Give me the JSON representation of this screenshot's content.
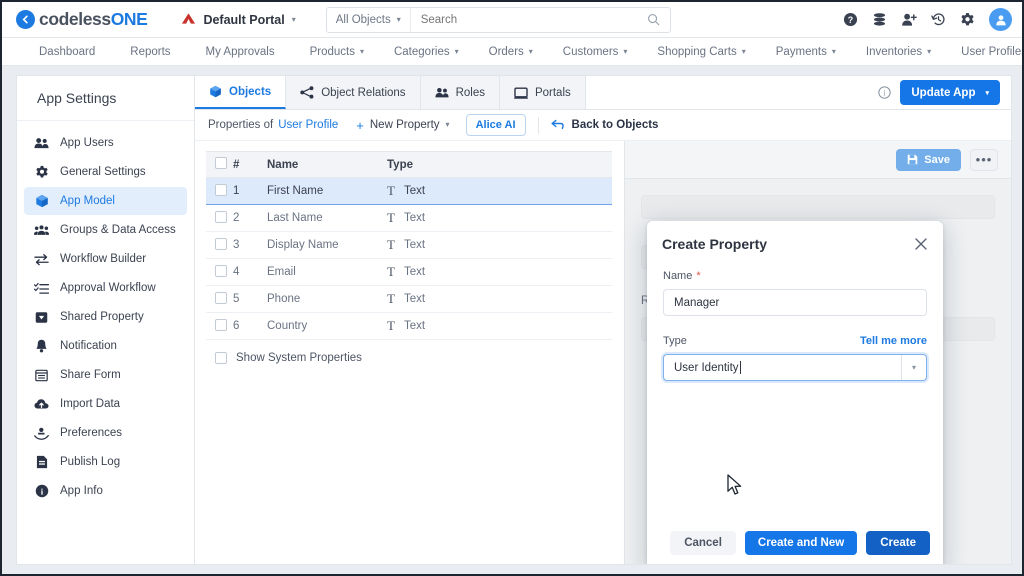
{
  "header": {
    "logo_mark": "circle-arrow-icon",
    "logo_text_1": "codeless",
    "logo_text_2": "ONE",
    "portal_icon": "portal-icon",
    "portal_name": "Default Portal",
    "portal_caret": "▾",
    "search": {
      "scope_label": "All Objects",
      "scope_caret": "▾",
      "placeholder": "Search",
      "value": "",
      "icon": "search-icon"
    },
    "icons": [
      {
        "name": "help-icon"
      },
      {
        "name": "database-icon"
      },
      {
        "name": "add-user-icon"
      },
      {
        "name": "history-icon"
      },
      {
        "name": "gear-icon"
      },
      {
        "name": "avatar-icon"
      }
    ]
  },
  "nav": {
    "items": [
      {
        "label": "Dashboard",
        "caret": ""
      },
      {
        "label": "Reports",
        "caret": ""
      },
      {
        "label": "My Approvals",
        "caret": ""
      },
      {
        "label": "Products",
        "caret": "▾"
      },
      {
        "label": "Categories",
        "caret": "▾"
      },
      {
        "label": "Orders",
        "caret": "▾"
      },
      {
        "label": "Customers",
        "caret": "▾"
      },
      {
        "label": "Shopping Carts",
        "caret": "▾"
      },
      {
        "label": "Payments",
        "caret": "▾"
      },
      {
        "label": "Inventories",
        "caret": "▾"
      },
      {
        "label": "User Profiles",
        "caret": "▾"
      }
    ]
  },
  "sidebar": {
    "title": "App Settings",
    "items": [
      {
        "label": "App Users",
        "icon": "users-icon",
        "active": false
      },
      {
        "label": "General Settings",
        "icon": "gear-icon",
        "active": false
      },
      {
        "label": "App Model",
        "icon": "cube-icon",
        "active": true
      },
      {
        "label": "Groups & Data Access",
        "icon": "group-users-icon",
        "active": false
      },
      {
        "label": "Workflow Builder",
        "icon": "arrows-icon",
        "active": false
      },
      {
        "label": "Approval Workflow",
        "icon": "checklist-icon",
        "active": false
      },
      {
        "label": "Shared Property",
        "icon": "tag-icon",
        "active": false
      },
      {
        "label": "Notification",
        "icon": "bell-icon",
        "active": false
      },
      {
        "label": "Share Form",
        "icon": "form-icon",
        "active": false
      },
      {
        "label": "Import Data",
        "icon": "cloud-upload-icon",
        "active": false
      },
      {
        "label": "Preferences",
        "icon": "preferences-icon",
        "active": false
      },
      {
        "label": "Publish Log",
        "icon": "document-icon",
        "active": false
      },
      {
        "label": "App Info",
        "icon": "info-icon",
        "active": false
      }
    ]
  },
  "main": {
    "tabs": [
      {
        "label": "Objects",
        "icon": "cube-icon",
        "active": true
      },
      {
        "label": "Object Relations",
        "icon": "relations-icon",
        "active": false
      },
      {
        "label": "Roles",
        "icon": "users-icon",
        "active": false
      },
      {
        "label": "Portals",
        "icon": "portal-window-icon",
        "active": false
      }
    ],
    "info_icon": "info-icon",
    "update_app_label": "Update App",
    "update_app_caret": "▾",
    "toolbar": {
      "properties_of_label": "Properties of",
      "object_name": "User Profile",
      "new_property_label": "New Property",
      "new_property_plus": "+",
      "new_property_caret": "▾",
      "alice_ai_label": "Alice AI",
      "back_label": "Back to Objects",
      "back_icon": "back-arrow-icon"
    },
    "table": {
      "columns": [
        "",
        "#",
        "Name",
        "Type"
      ],
      "rows": [
        {
          "num": "1",
          "name": "First Name",
          "type": "Text",
          "selected": true
        },
        {
          "num": "2",
          "name": "Last Name",
          "type": "Text",
          "selected": false
        },
        {
          "num": "3",
          "name": "Display Name",
          "type": "Text",
          "selected": false
        },
        {
          "num": "4",
          "name": "Email",
          "type": "Text",
          "selected": false
        },
        {
          "num": "5",
          "name": "Phone",
          "type": "Text",
          "selected": false
        },
        {
          "num": "6",
          "name": "Country",
          "type": "Text",
          "selected": false
        }
      ],
      "type_symbol": "T",
      "show_system_label": "Show System Properties"
    },
    "detail": {
      "save_label": "Save",
      "save_icon": "floppy-icon",
      "more_label": "•••",
      "readonly_label": "Read-Only"
    }
  },
  "modal": {
    "title": "Create Property",
    "close_icon": "close-icon",
    "name_label": "Name",
    "name_required": "*",
    "name_value": "Manager",
    "type_label": "Type",
    "tell_me_more": "Tell me more",
    "type_value": "User Identity",
    "type_caret": "▾",
    "cancel_label": "Cancel",
    "create_and_new_label": "Create and New",
    "create_label": "Create"
  },
  "colors": {
    "accent": "#1576e8",
    "accent_dark": "#1361c4",
    "link": "#1d7ae0",
    "selected_row": "#ddeafb",
    "required": "#e0514b",
    "save_button": "#73aeea"
  }
}
